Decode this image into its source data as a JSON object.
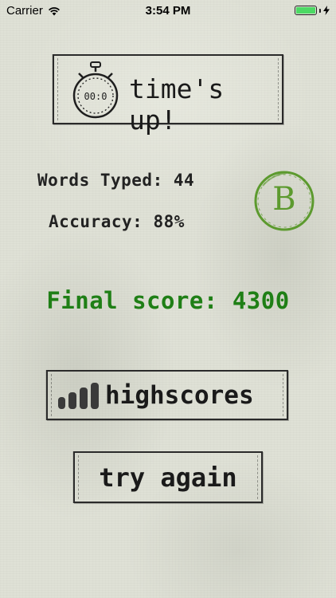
{
  "status_bar": {
    "carrier": "Carrier",
    "time": "3:54 PM",
    "battery_percent": 100,
    "icons": [
      "wifi-icon",
      "battery-icon",
      "charging-bolt-icon"
    ]
  },
  "results": {
    "header_label": "time's up!",
    "stopwatch_time": "00:0",
    "words_typed_label": "Words Typed:",
    "words_typed_value": "44",
    "accuracy_label": "Accuracy:",
    "accuracy_value": "88%",
    "grade": "B",
    "final_score_label": "Final score:",
    "final_score_value": "4300"
  },
  "actions": {
    "highscores_label": "highscores",
    "try_again_label": "try again"
  },
  "colors": {
    "grade_green": "#5c9a2e",
    "score_green": "#1f7f16",
    "ink": "#1a1a1a",
    "paper": "#dfe1d6"
  }
}
